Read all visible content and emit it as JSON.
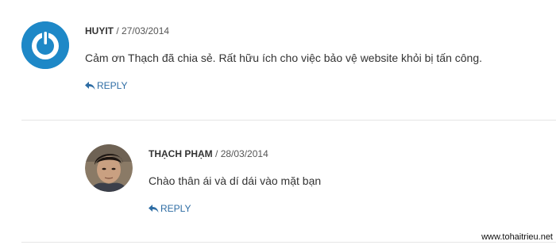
{
  "comments": [
    {
      "author": "HUYIT",
      "date": "27/03/2014",
      "separator": " / ",
      "text": "Cảm ơn Thạch đã chia sẻ. Rất hữu ích cho việc bảo vệ website khỏi bị tấn công.",
      "reply_label": "REPLY",
      "avatar_icon": "power-logo-icon",
      "avatar_color": "#1e88c7"
    },
    {
      "author": "THẠCH PHẠM",
      "date": "28/03/2014",
      "separator": " / ",
      "text": "Chào thân ái và dí dái vào mặt bạn",
      "reply_label": "REPLY",
      "avatar_icon": "user-photo",
      "avatar_color": "#6b5a4a"
    }
  ],
  "watermark": "www.tohaitrieu.net",
  "colors": {
    "link": "#2e6da4",
    "divider": "#e5e5e5"
  }
}
